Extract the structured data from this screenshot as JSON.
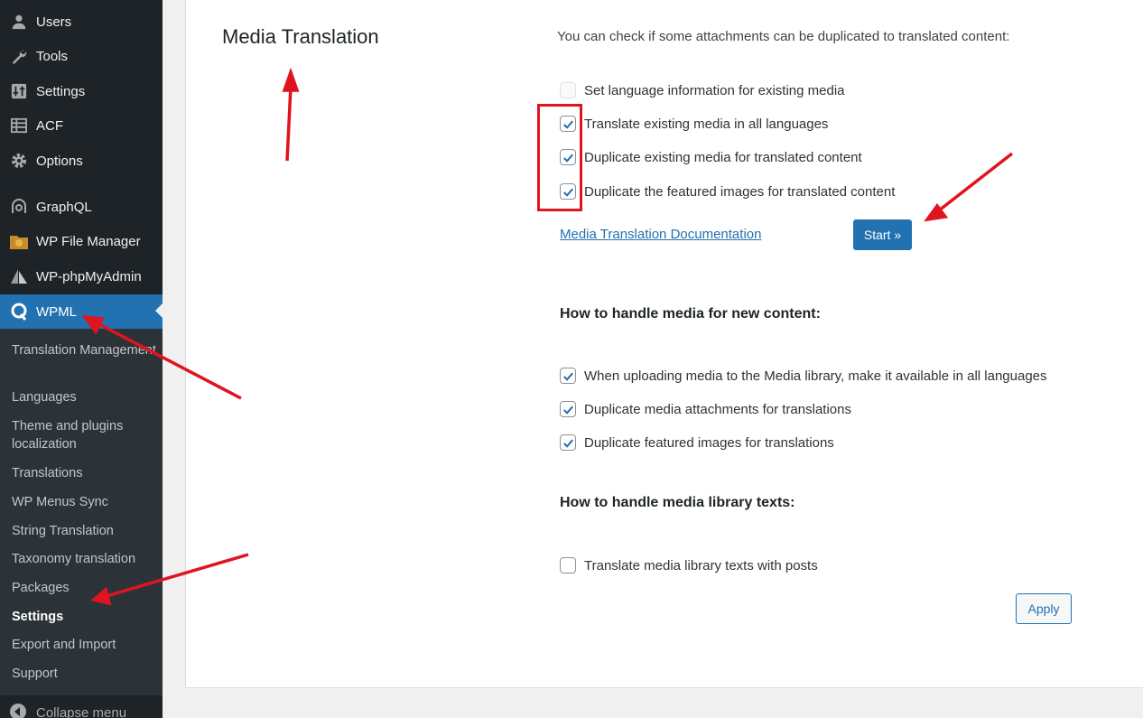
{
  "sidebar": {
    "items": [
      {
        "label": "Users",
        "icon": "users-icon"
      },
      {
        "label": "Tools",
        "icon": "wrench-icon"
      },
      {
        "label": "Settings",
        "icon": "settings-sliders-icon"
      },
      {
        "label": "ACF",
        "icon": "grid-table-icon"
      },
      {
        "label": "Options",
        "icon": "gear-icon"
      },
      {
        "label": "GraphQL",
        "icon": "graphql-icon"
      },
      {
        "label": "WP File Manager",
        "icon": "folder-icon"
      },
      {
        "label": "WP-phpMyAdmin",
        "icon": "sailboat-icon"
      },
      {
        "label": "WPML",
        "icon": "wpml-logo-icon"
      }
    ],
    "submenu": [
      "Translation Management",
      "Languages",
      "Theme and plugins localization",
      "Translations",
      "WP Menus Sync",
      "String Translation",
      "Taxonomy translation",
      "Packages",
      "Settings",
      "Export and Import",
      "Support"
    ],
    "collapse_label": "Collapse menu",
    "accent": "#2271b1"
  },
  "main": {
    "section_title": "Media Translation",
    "intro": "You can check if some attachments can be duplicated to translated content:",
    "existing_options": [
      {
        "label": "Set language information for existing media",
        "checked": false
      },
      {
        "label": "Translate existing media in all languages",
        "checked": true
      },
      {
        "label": "Duplicate existing media for translated content",
        "checked": true
      },
      {
        "label": "Duplicate the featured images for translated content",
        "checked": true
      }
    ],
    "doc_link": "Media Translation Documentation",
    "start_label": "Start »",
    "new_content_heading": "How to handle media for new content:",
    "new_content_options": [
      {
        "label": "When uploading media to the Media library, make it available in all languages",
        "checked": true
      },
      {
        "label": "Duplicate media attachments for translations",
        "checked": true
      },
      {
        "label": "Duplicate featured images for translations",
        "checked": true
      }
    ],
    "library_heading": "How to handle media library texts:",
    "library_options": [
      {
        "label": "Translate media library texts with posts",
        "checked": false
      }
    ],
    "apply_label": "Apply"
  }
}
